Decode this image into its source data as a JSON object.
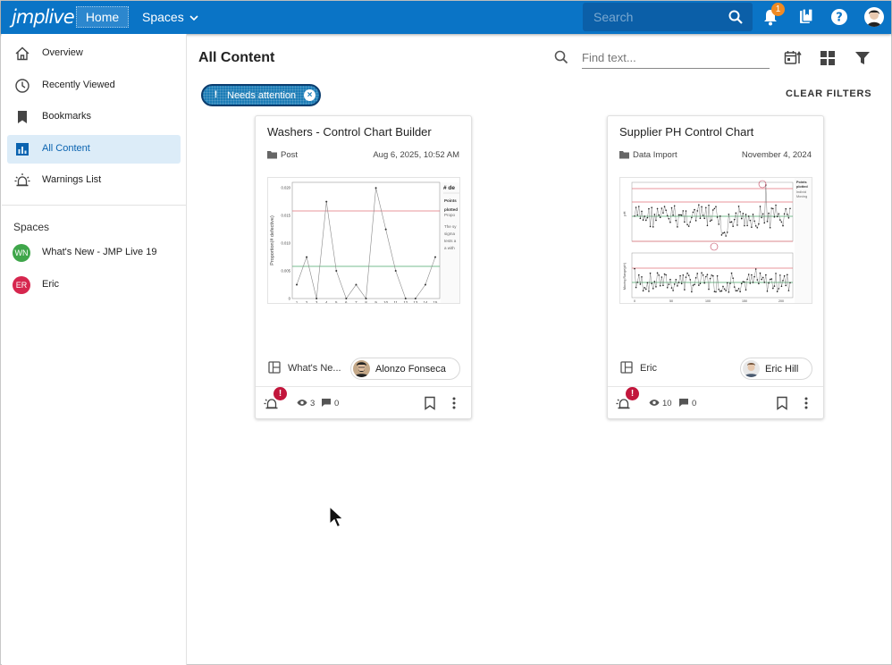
{
  "header": {
    "logo_text": "jmplive",
    "home_label": "Home",
    "spaces_label": "Spaces",
    "search_placeholder": "Search",
    "notification_count": "1",
    "accent": "#0a74c6"
  },
  "sidebar": {
    "items": [
      {
        "label": "Overview",
        "icon": "home-icon"
      },
      {
        "label": "Recently Viewed",
        "icon": "clock-icon"
      },
      {
        "label": "Bookmarks",
        "icon": "bookmark-icon"
      },
      {
        "label": "All Content",
        "icon": "chart-icon",
        "active": true
      },
      {
        "label": "Warnings List",
        "icon": "siren-icon"
      }
    ],
    "spaces_heading": "Spaces",
    "spaces": [
      {
        "initials": "WN",
        "label": "What's New - JMP Live 19",
        "color": "#3fa64a"
      },
      {
        "initials": "ER",
        "label": "Eric",
        "color": "#d6264e"
      }
    ]
  },
  "main": {
    "title": "All Content",
    "find_placeholder": "Find text...",
    "filter_chip": "Needs attention",
    "clear_filters": "CLEAR FILTERS"
  },
  "cards": [
    {
      "title": "Washers - Control Chart Builder",
      "type": "Post",
      "date": "Aug 6, 2025, 10:52 AM",
      "space": "What's Ne...",
      "author": "Alonzo Fonseca",
      "views": "3",
      "comments": "0",
      "thumb": {
        "ylabel": "Proportion(# defective)",
        "yticks": [
          "0.020",
          "0.015",
          "0.010",
          "0.005",
          "0"
        ],
        "xticks": [
          "1",
          "2",
          "3",
          "4",
          "5",
          "6",
          "7",
          "8",
          "9",
          "10",
          "11",
          "12",
          "13",
          "14",
          "15"
        ],
        "side_heading": "# de",
        "side_lines": [
          "Points",
          "plotted",
          "Propo",
          "The sy",
          "sigma",
          "tests a",
          "a with"
        ],
        "values": [
          0.0025,
          0.0075,
          0,
          0.0175,
          0.005,
          0,
          0.0025,
          0,
          0.02,
          0.0125,
          0.005,
          0,
          0,
          0.0025,
          0.0075
        ]
      }
    },
    {
      "title": "Supplier PH Control Chart",
      "type": "Data Import",
      "date": "November 4, 2024",
      "space": "Eric",
      "author": "Eric Hill",
      "views": "10",
      "comments": "0",
      "thumb": {
        "ylabel": "pH",
        "ylabel2": "Moving Range(pH)",
        "xticks": [
          "0",
          "50",
          "100",
          "150",
          "200"
        ],
        "side_lines": [
          "Points",
          "plotted",
          "Individ",
          "Moving"
        ]
      }
    }
  ]
}
